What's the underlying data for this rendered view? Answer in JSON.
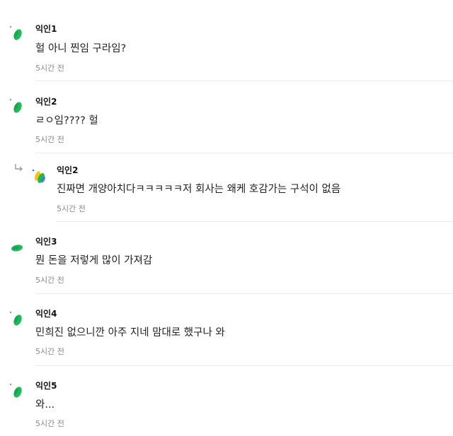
{
  "comments": [
    {
      "author": "익인1",
      "text": "헐 아니 찐임 구라임?",
      "time": "5시간 전",
      "avatar_icon": "green-leaf-avatar",
      "is_reply": false
    },
    {
      "author": "익인2",
      "text": "ㄹㅇ임???? 헐",
      "time": "5시간 전",
      "avatar_icon": "green-leaf-avatar",
      "is_reply": false
    },
    {
      "author": "익인2",
      "text": "진짜면 개양아치다ㅋㅋㅋㅋㅋ저 회사는 왜케 호감가는 구석이 없음",
      "time": "5시간 전",
      "avatar_icon": "multicolor-leaf-avatar",
      "is_reply": true
    },
    {
      "author": "익인3",
      "text": "뭔 돈을 저렇게 많이 가져감",
      "time": "5시간 전",
      "avatar_icon": "green-leaf-avatar",
      "is_reply": false
    },
    {
      "author": "익인4",
      "text": "민희진 없으니깐 아주 지네 맘대로 했구나 와",
      "time": "5시간 전",
      "avatar_icon": "green-leaf-avatar",
      "is_reply": false
    },
    {
      "author": "익인5",
      "text": "와...",
      "time": "5시간 전",
      "avatar_icon": "green-leaf-avatar",
      "is_reply": false
    }
  ],
  "colors": {
    "leaf_green": "#1fb85a",
    "leaf_dark": "#0d8f43",
    "reply_yellow": "#f2c811",
    "reply_blue": "#3a7bd5",
    "divider": "#ececec"
  },
  "icons": {
    "reply_indicator": "reply-arrow-icon"
  }
}
